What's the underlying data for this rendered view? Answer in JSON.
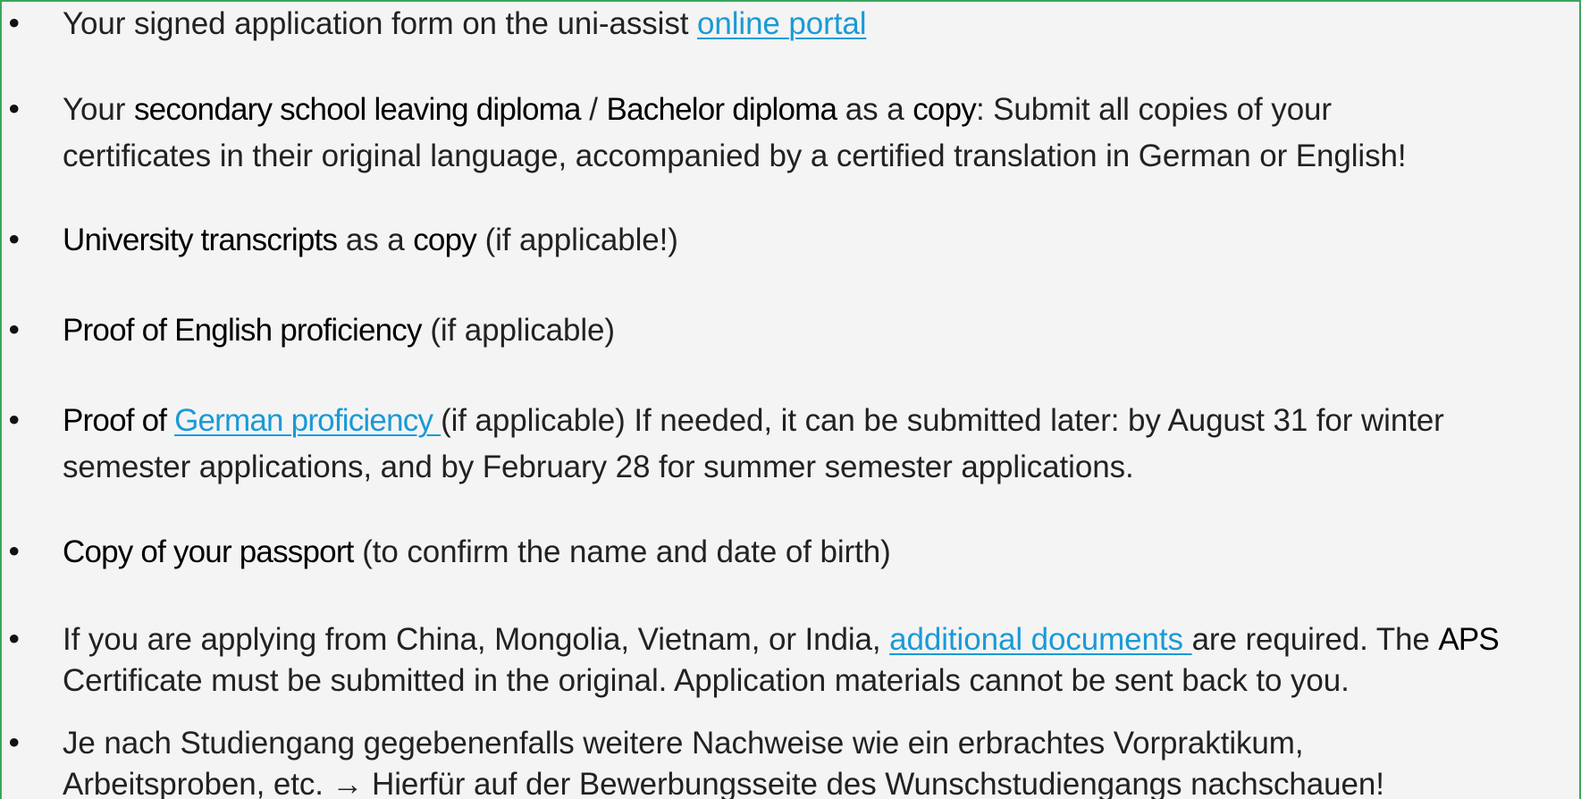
{
  "bullet_char": "•",
  "items": [
    {
      "line1": {
        "t1": "Your signed application form on the uni-assist ",
        "link": "online portal"
      }
    },
    {
      "line1": {
        "t1": "Your ",
        "b1": "secondary school leaving diploma",
        "t2": " / ",
        "b2": "Bachelor diploma",
        "t3": " as a ",
        "b3": "copy",
        "t4": ": Submit all copies of your"
      },
      "line2": "certificates in their original language, accompanied by a certified translation in German or English!"
    },
    {
      "line1": {
        "b1": "University transcripts",
        "t1": " as a ",
        "b2": "copy",
        "t2": " (if applicable!)"
      }
    },
    {
      "line1": {
        "b1": "Proof of English proficiency",
        "t1": " (if applicable)"
      }
    },
    {
      "line1": {
        "b1": "Proof of ",
        "link": "German proficiency ",
        "t1": "(if applicable) If needed, it can be submitted later: by August 31 for winter"
      },
      "line2": "semester applications, and by February 28 for summer semester applications."
    },
    {
      "line1": {
        "b1": "Copy of your passport",
        "t1": " (to confirm the name and date of birth)"
      }
    },
    {
      "line1": {
        "t1": "If you are applying from China, Mongolia, Vietnam, or India, ",
        "link": "additional documents ",
        "t2": "are required. The ",
        "b1": "APS"
      },
      "line2": "Certificate must be submitted in the original. Application materials cannot be sent back to you."
    },
    {
      "line1": "Je nach Studiengang gegebenenfalls weitere Nachweise wie ein erbrachtes Vorpraktikum,",
      "line2": "Arbeitsproben, etc. → Hierfür auf der Bewerbungsseite des Wunschstudiengangs nachschauen!"
    }
  ]
}
